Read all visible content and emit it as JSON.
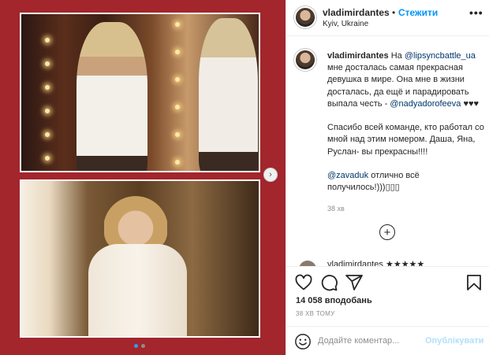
{
  "post": {
    "username": "vladimirdantes",
    "follow_sep": "•",
    "follow_label": "Стежити",
    "location": "Kyiv, Ukraine",
    "more_label": "•••"
  },
  "caption": {
    "username": "vladimirdantes",
    "part1": "На",
    "mention1": "@lipsyncbattle_ua",
    "part2": "мне досталась самая прекрасная девушка в мире. Она мне в жизни досталась, да ещё и парадировать выпала честь -",
    "mention2": "@nadyadorofeeva",
    "hearts": "♥♥♥",
    "para2": "Спасибо всей команде, кто работал со мной над этим номером. Даша, Яна, Руслан- вы прекрасны!!!!",
    "mention3": "@zavaduk",
    "part3": "отлично всё получилось!)))▯▯▯",
    "time": "38 хв"
  },
  "load_more_label": "+",
  "comment_peek_text": "vladimirdantes ★★★★★",
  "likes": "14 058 вподобань",
  "date": "38 ХВ ТОМУ",
  "comment_box": {
    "placeholder": "Додайте коментар...",
    "publish_label": "Опублікувати"
  },
  "carousel": {
    "next_glyph": "›",
    "slide_count": 2,
    "active_slide": 1
  },
  "colors": {
    "media_background": "#a2262c",
    "accent": "#0095f6",
    "publish_disabled": "#b2dffc"
  },
  "icons": [
    "heart-icon",
    "comment-icon",
    "share-icon",
    "bookmark-icon",
    "emoji-icon",
    "add-circle-icon",
    "more-icon",
    "chevron-right-icon"
  ]
}
